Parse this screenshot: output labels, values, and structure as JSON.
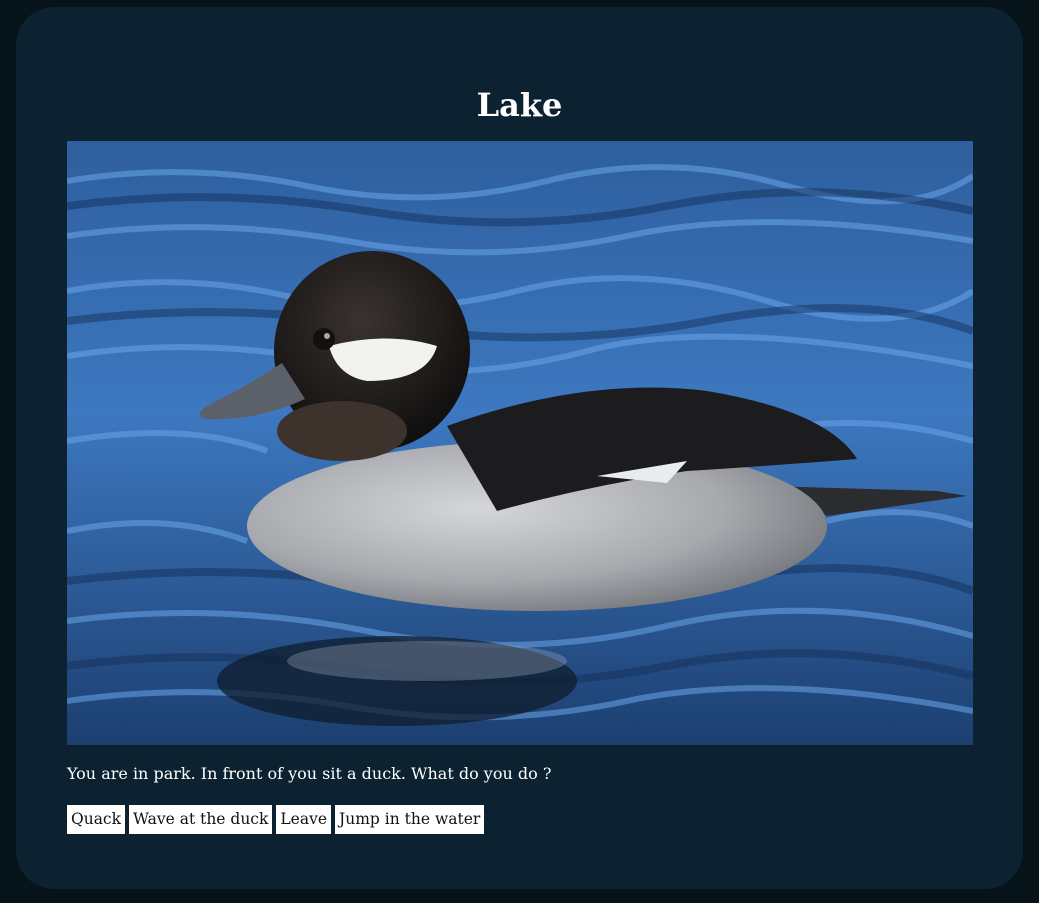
{
  "room": {
    "title": "Lake",
    "image_subject": "duck-on-water",
    "description": "You are in park. In front of you sit a duck. What do you do ?"
  },
  "choices": [
    {
      "label": "Quack"
    },
    {
      "label": "Wave at the duck"
    },
    {
      "label": "Leave"
    },
    {
      "label": "Jump in the water"
    }
  ],
  "colors": {
    "page_background": "#061318",
    "card_background": "#0c2230",
    "text": "#ffffff",
    "button_background": "#ffffff",
    "water": "#3f74b8"
  }
}
